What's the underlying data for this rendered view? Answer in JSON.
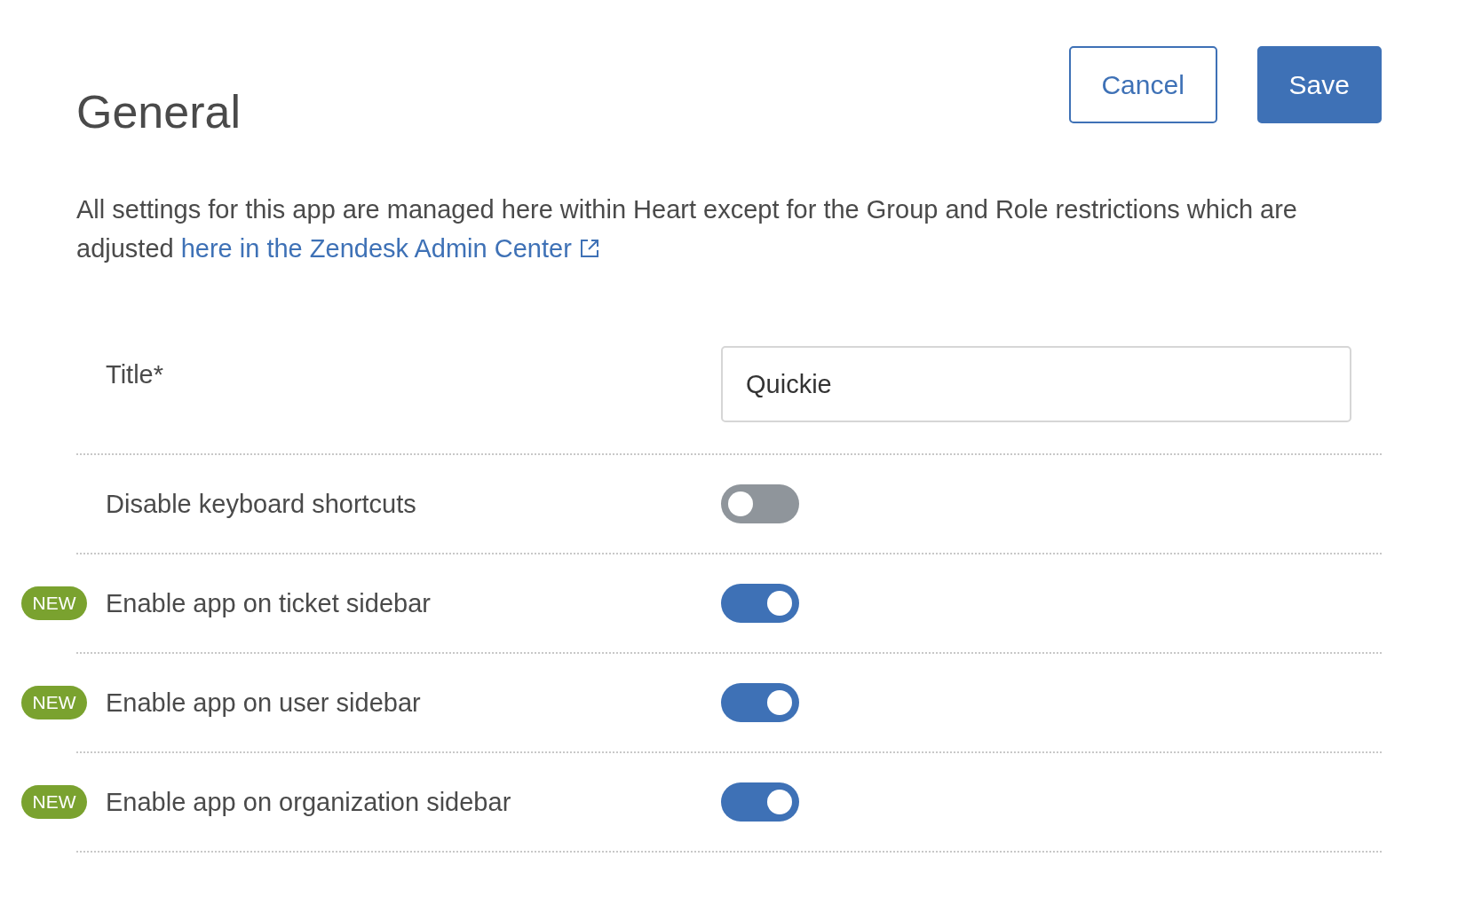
{
  "header": {
    "title": "General",
    "buttons": [
      {
        "label": "Cancel",
        "kind": "secondary"
      },
      {
        "label": "Save",
        "kind": "primary"
      }
    ]
  },
  "description": {
    "text": "All settings for this app are managed here within Heart except for the Group and Role restrictions which are adjusted ",
    "link": "here in the Zendesk Admin Center"
  },
  "settings": [
    {
      "kind": "text",
      "label": "Title*",
      "value": "Quickie"
    },
    {
      "kind": "toggle",
      "label": "Disable keyboard shortcuts",
      "on": false
    },
    {
      "kind": "toggle",
      "label": "Enable app on ticket sidebar",
      "on": true,
      "badge": "NEW"
    },
    {
      "kind": "toggle",
      "label": "Enable app on user sidebar",
      "on": true,
      "badge": "NEW"
    },
    {
      "kind": "toggle",
      "label": "Enable app on organization sidebar",
      "on": true,
      "badge": "NEW"
    }
  ]
}
